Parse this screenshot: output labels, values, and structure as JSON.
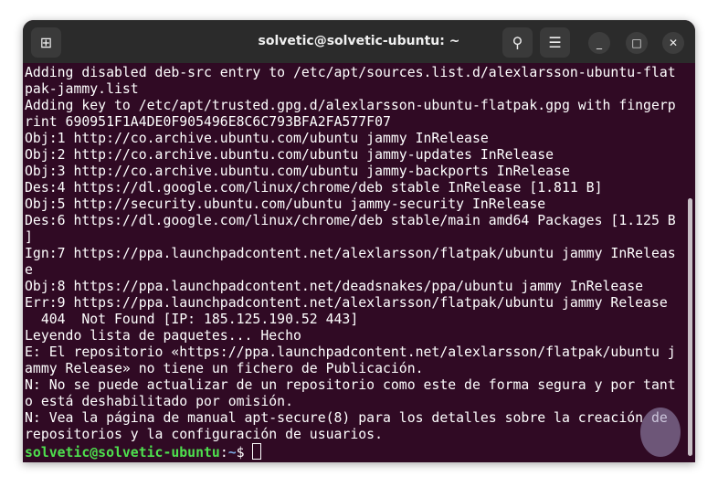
{
  "window": {
    "title": "solvetic@solvetic-ubuntu: ~"
  },
  "icons": {
    "new_tab": "new-tab-icon",
    "search": "search-icon",
    "menu": "hamburger-icon",
    "minimize": "minimize-icon",
    "maximize": "maximize-icon",
    "close": "close-icon"
  },
  "glyphs": {
    "new_tab": "⊞",
    "search": "⚲",
    "menu": "☰",
    "minimize": "_",
    "maximize": "□",
    "close": "✕"
  },
  "terminal": {
    "lines": [
      "Adding disabled deb-src entry to /etc/apt/sources.list.d/alexlarsson-ubuntu-flat",
      "pak-jammy.list",
      "Adding key to /etc/apt/trusted.gpg.d/alexlarsson-ubuntu-flatpak.gpg with fingerp",
      "rint 690951F1A4DE0F905496E8C6C793BFA2FA577F07",
      "Obj:1 http://co.archive.ubuntu.com/ubuntu jammy InRelease",
      "Obj:2 http://co.archive.ubuntu.com/ubuntu jammy-updates InRelease",
      "Obj:3 http://co.archive.ubuntu.com/ubuntu jammy-backports InRelease",
      "Des:4 https://dl.google.com/linux/chrome/deb stable InRelease [1.811 B]",
      "Obj:5 http://security.ubuntu.com/ubuntu jammy-security InRelease",
      "Des:6 https://dl.google.com/linux/chrome/deb stable/main amd64 Packages [1.125 B",
      "]",
      "Ign:7 https://ppa.launchpadcontent.net/alexlarsson/flatpak/ubuntu jammy InReleas",
      "e",
      "Obj:8 https://ppa.launchpadcontent.net/deadsnakes/ppa/ubuntu jammy InRelease",
      "Err:9 https://ppa.launchpadcontent.net/alexlarsson/flatpak/ubuntu jammy Release",
      "  404  Not Found [IP: 185.125.190.52 443]",
      "Leyendo lista de paquetes... Hecho",
      "E: El repositorio «https://ppa.launchpadcontent.net/alexlarsson/flatpak/ubuntu j",
      "ammy Release» no tiene un fichero de Publicación.",
      "N: No se puede actualizar de un repositorio como este de forma segura y por tant",
      "o está deshabilitado por omisión.",
      "N: Vea la página de manual apt-secure(8) para los detalles sobre la creación de",
      "repositorios y la configuración de usuarios."
    ],
    "prompt": {
      "user_host": "solvetic@solvetic-ubuntu",
      "sep": ":",
      "path": "~",
      "symbol": "$ "
    }
  }
}
